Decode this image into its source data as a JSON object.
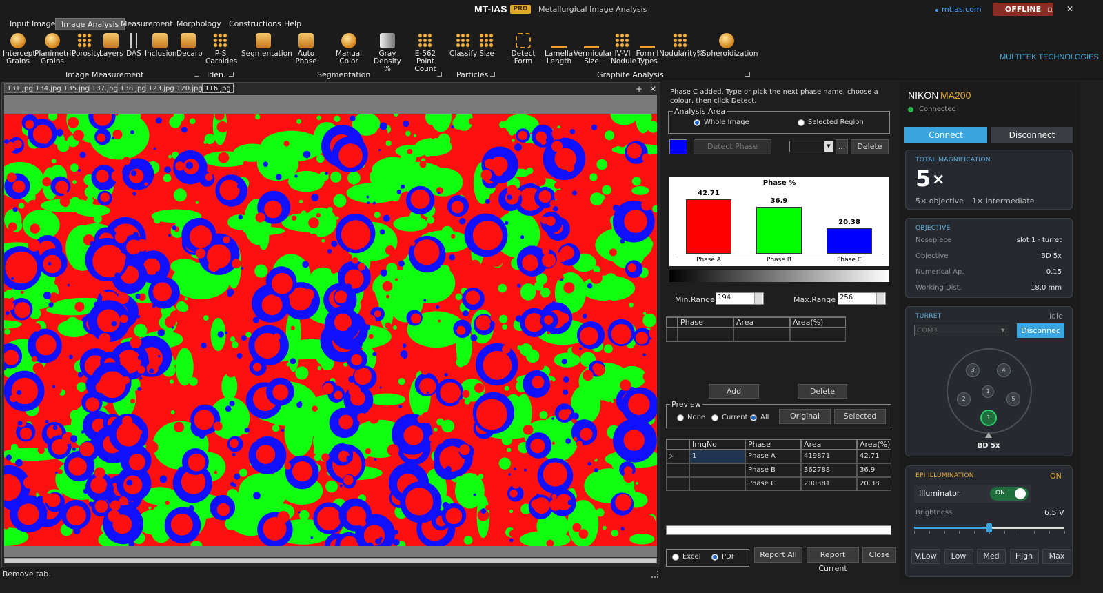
{
  "window": {
    "title": "MT-IAS",
    "badge": "PRO",
    "subtitle": "Metallurgical Image Analysis",
    "site": "mtias.com",
    "status": "OFFLINE",
    "min": "–",
    "max": "▫",
    "close": "✕"
  },
  "menu": [
    "Input Image",
    "Image Analysis",
    "Measurement",
    "Morphology",
    "Constructions",
    "Help"
  ],
  "ribbon": {
    "buttons": [
      {
        "l1": "Intercept",
        "l2": "Grains"
      },
      {
        "l1": "Planimetric",
        "l2": "Grains"
      },
      {
        "l1": "Porosity",
        "l2": ""
      },
      {
        "l1": "Layers",
        "l2": ""
      },
      {
        "l1": "DAS",
        "l2": ""
      },
      {
        "l1": "Inclusion",
        "l2": ""
      },
      {
        "l1": "Decarb",
        "l2": ""
      },
      {
        "l1": "P-S",
        "l2": "Carbides"
      },
      {
        "l1": "Segmentation",
        "l2": ""
      },
      {
        "l1": "Auto Phase",
        "l2": ""
      },
      {
        "l1": "Manual Color",
        "l2": ""
      },
      {
        "l1": "Gray",
        "l2": "Density %"
      },
      {
        "l1": "E-562",
        "l2": "Point Count"
      },
      {
        "l1": "Classify",
        "l2": ""
      },
      {
        "l1": "Size",
        "l2": ""
      },
      {
        "l1": "Detect Form",
        "l2": ""
      },
      {
        "l1": "Lamellar",
        "l2": "Length"
      },
      {
        "l1": "Vermicular",
        "l2": "Size"
      },
      {
        "l1": "IV-VI",
        "l2": "Nodule"
      },
      {
        "l1": "Form I",
        "l2": "Types"
      },
      {
        "l1": "Nodularity%",
        "l2": ""
      },
      {
        "l1": "Spheroidization",
        "l2": ""
      }
    ],
    "groups": [
      "Image Measurement",
      "Iden...",
      "Segmentation",
      "Particles",
      "Graphite Analysis"
    ],
    "brand": "MULTITEK TECHNOLOGIES"
  },
  "file_tabs": [
    "131.jpg",
    "134.jpg",
    "135.jpg",
    "137.jpg",
    "138.jpg",
    "123.jpg",
    "120.jpg",
    "116.jpg"
  ],
  "tab_add": "+",
  "tab_close": "✕",
  "status_bar": "Remove tab.",
  "phase": {
    "instruction": "Phase C added. Type or pick the next phase name, choose a colour, then click Detect.",
    "analysis_area": "Analysis Area",
    "whole_image": "Whole Image",
    "selected_region": "Selected Region",
    "detect_phase": "Detect Phase",
    "more": "...",
    "delete": "Delete",
    "swatch_color": "#0000ff",
    "min_label": "Min.Range",
    "min_value": "194",
    "max_label": "Max.Range",
    "max_value": "256",
    "grid_headers": [
      "Phase",
      "Area",
      "Area(%)"
    ],
    "add": "Add",
    "delete2": "Delete",
    "preview": "Preview",
    "prev_none": "None",
    "prev_current": "Current",
    "prev_all": "All",
    "original": "Original",
    "selected": "Selected",
    "results_headers": [
      "ImgNo",
      "Phase",
      "Area",
      "Area(%)"
    ],
    "results": [
      {
        "img": "1",
        "phase": "Phase A",
        "area": "419871",
        "pct": "42.71"
      },
      {
        "img": "",
        "phase": "Phase B",
        "area": "362788",
        "pct": "36.9"
      },
      {
        "img": "",
        "phase": "Phase C",
        "area": "200381",
        "pct": "20.38"
      }
    ],
    "excel": "Excel",
    "pdf": "PDF",
    "report_all": "Report All",
    "report_current": "Report Current",
    "close": "Close"
  },
  "chart_data": {
    "type": "bar",
    "title": "Phase %",
    "categories": [
      "Phase A",
      "Phase B",
      "Phase C"
    ],
    "values": [
      42.71,
      36.9,
      20.38
    ],
    "colors": [
      "#ff0000",
      "#00ff00",
      "#0000ff"
    ],
    "ylim": [
      0,
      50
    ],
    "xlabel": "",
    "ylabel": ""
  },
  "microscope": {
    "brand": "NIKON",
    "model": "MA200",
    "conn_status": "Connected",
    "connect": "Connect",
    "disconnect": "Disconnect",
    "mag_caption": "TOTAL MAGNIFICATION",
    "mag_value": "5",
    "mag_unit": "×",
    "mag_detail_obj": "5× objective",
    "mag_detail_sep": "·",
    "mag_detail_int": "1× intermediate",
    "obj_caption": "OBJECTIVE",
    "obj_rows": [
      {
        "k": "Nosepiece",
        "v": "slot 1  ·  turret"
      },
      {
        "k": "Objective",
        "v": "BD 5x"
      },
      {
        "k": "Numerical Ap.",
        "v": "0.15"
      },
      {
        "k": "Working Dist.",
        "v": "18.0 mm"
      }
    ],
    "turret_caption": "TURRET",
    "turret_state": "idle",
    "com_port": "COM3",
    "turret_disconnect": "Disconnec",
    "slots": [
      "3",
      "4",
      "2",
      "1",
      "5",
      "1"
    ],
    "turret_label": "BD 5x",
    "epi_caption": "EPI ILLUMINATION",
    "epi_state": "ON",
    "illuminator": "Illuminator",
    "toggle": "ON",
    "brightness_label": "Brightness",
    "brightness_value": "6.5 V",
    "brightness_level": 0.5,
    "levels": [
      "V.Low",
      "Low",
      "Med",
      "High",
      "Max"
    ]
  }
}
